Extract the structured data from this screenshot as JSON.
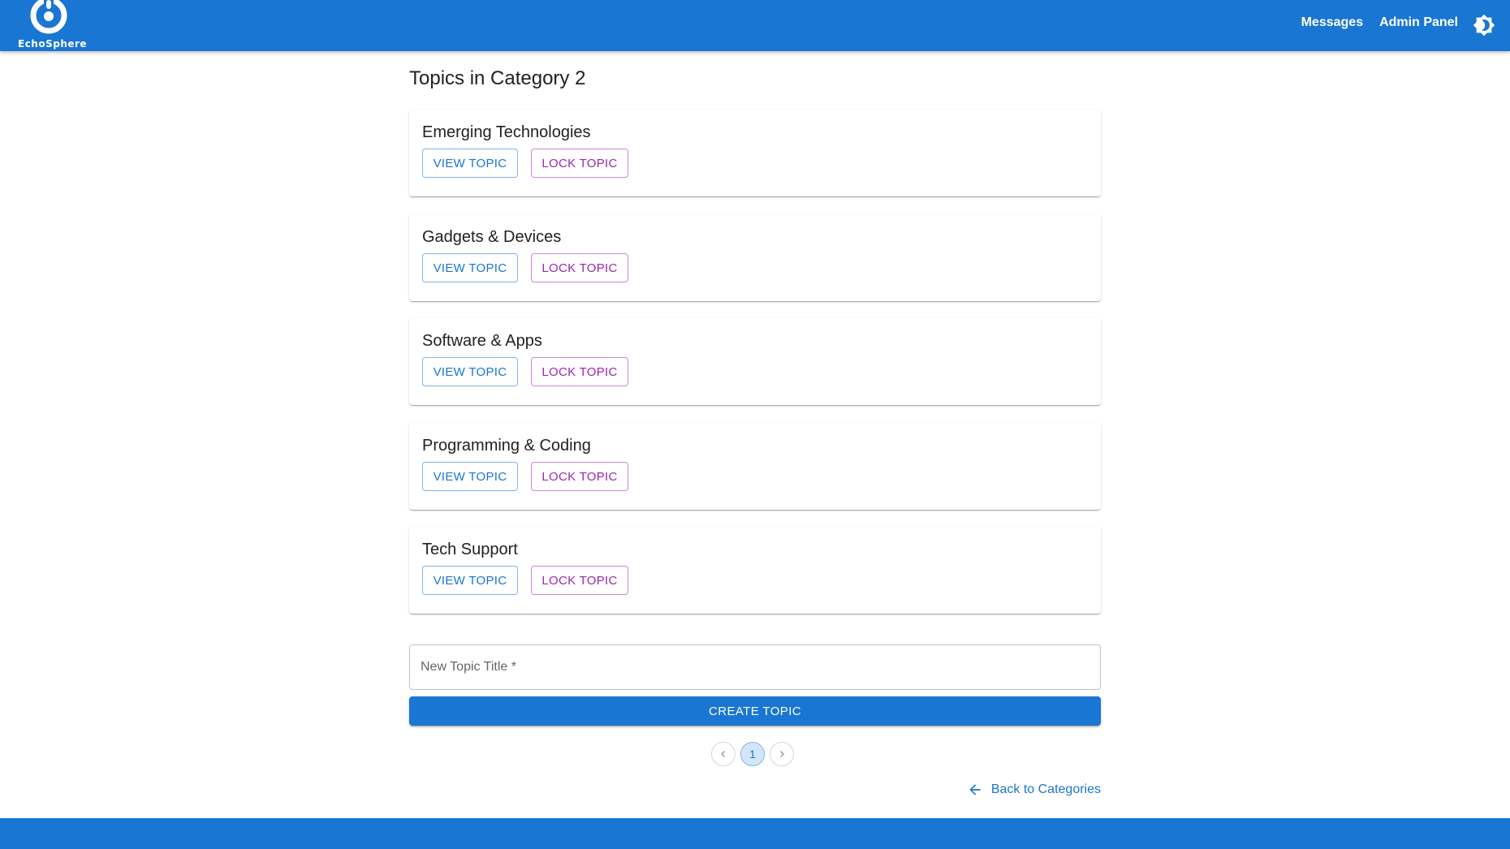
{
  "header": {
    "logo_text": "EchoSphere",
    "nav": {
      "messages": "Messages",
      "admin_panel": "Admin Panel"
    },
    "theme_icon": "brightness-icon"
  },
  "main": {
    "title": "Topics in Category 2",
    "topics": [
      {
        "title": "Emerging Technologies",
        "view_label": "VIEW TOPIC",
        "lock_label": "LOCK TOPIC"
      },
      {
        "title": "Gadgets & Devices",
        "view_label": "VIEW TOPIC",
        "lock_label": "LOCK TOPIC"
      },
      {
        "title": "Software & Apps",
        "view_label": "VIEW TOPIC",
        "lock_label": "LOCK TOPIC"
      },
      {
        "title": "Programming & Coding",
        "view_label": "VIEW TOPIC",
        "lock_label": "LOCK TOPIC"
      },
      {
        "title": "Tech Support",
        "view_label": "VIEW TOPIC",
        "lock_label": "LOCK TOPIC"
      }
    ],
    "new_topic": {
      "label": "New Topic Title *",
      "value": ""
    },
    "create_label": "CREATE TOPIC",
    "pagination": {
      "current_page": "1"
    },
    "back_label": "Back to Categories"
  },
  "colors": {
    "primary": "#1976d2",
    "secondary": "#9c27b0",
    "background": "#ffffff"
  }
}
